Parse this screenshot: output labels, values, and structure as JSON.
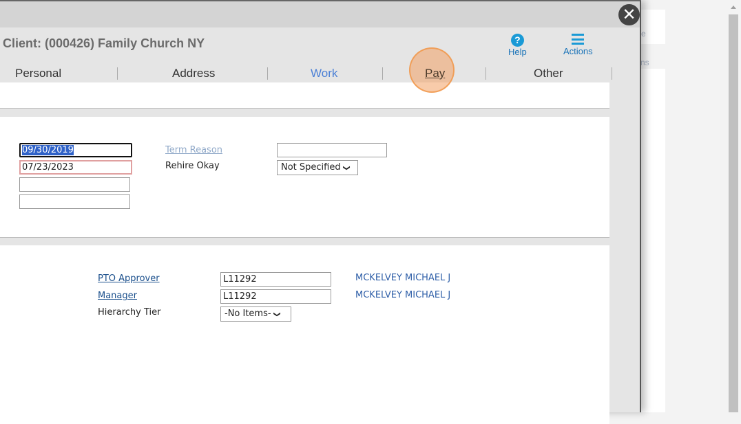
{
  "background": {
    "card1_text": "e",
    "card2_text": "ns"
  },
  "modal": {
    "client_title": "Client: (000426) Family Church NY",
    "help_label": "Help",
    "actions_label": "Actions",
    "tabs": [
      {
        "label": "Personal"
      },
      {
        "label": "Address"
      },
      {
        "label": "Work",
        "active": true
      },
      {
        "label": "Pay"
      },
      {
        "label": "Other"
      }
    ]
  },
  "dates": {
    "date1": "09/30/2019",
    "date2": "07/23/2023",
    "date3": "",
    "date4": ""
  },
  "termination": {
    "term_reason_label": "Term Reason",
    "term_reason_value": "",
    "rehire_label": "Rehire Okay",
    "rehire_value": "Not Specified"
  },
  "hierarchy": {
    "pto_approver_label": "PTO Approver",
    "pto_approver_value": "L11292",
    "pto_approver_name": "MCKELVEY MICHAEL J",
    "manager_label": "Manager",
    "manager_value": "L11292",
    "manager_name": "MCKELVEY MICHAEL J",
    "tier_label": "Hierarchy Tier",
    "tier_value": "-No Items-"
  },
  "colors": {
    "accent": "#1a9ad6",
    "active_tab": "#4a7fd6",
    "highlight": "#f2a064"
  }
}
